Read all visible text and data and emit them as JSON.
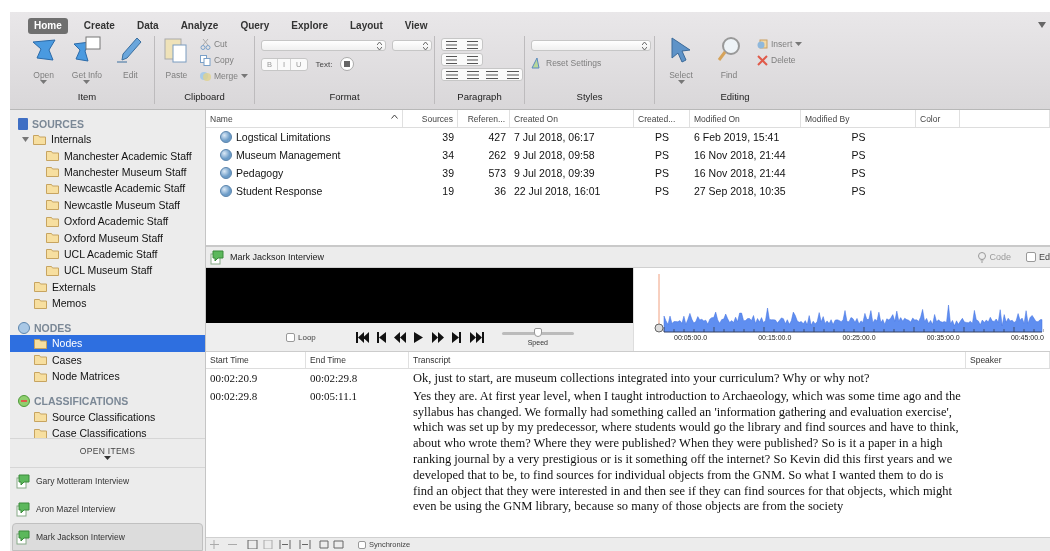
{
  "ribbon": {
    "tabs": [
      {
        "label": "Home",
        "selected": true
      },
      {
        "label": "Create",
        "selected": false
      },
      {
        "label": "Data",
        "selected": false
      },
      {
        "label": "Analyze",
        "selected": false
      },
      {
        "label": "Query",
        "selected": false
      },
      {
        "label": "Explore",
        "selected": false
      },
      {
        "label": "Layout",
        "selected": false
      },
      {
        "label": "View",
        "selected": false
      }
    ],
    "groups": [
      {
        "kind": "item",
        "label": "Item",
        "buttons": [
          {
            "label": "Open",
            "dropdown": true,
            "disabled": true
          },
          {
            "label": "Get Info",
            "dropdown": true,
            "disabled": true
          },
          {
            "label": "Edit",
            "dropdown": false,
            "disabled": true
          }
        ]
      },
      {
        "kind": "clipboard",
        "label": "Clipboard",
        "buttons": [
          {
            "label": "Paste",
            "dropdown": false,
            "disabled": true
          }
        ],
        "small_buttons": [
          {
            "label": "Cut",
            "dropdown": false,
            "disabled": true
          },
          {
            "label": "Copy",
            "dropdown": false,
            "disabled": true
          },
          {
            "label": "Merge",
            "dropdown": true,
            "disabled": true
          }
        ]
      },
      {
        "kind": "format",
        "label": "Format",
        "styles": [
          "B",
          "I",
          "U"
        ],
        "text_label": "Text:"
      },
      {
        "kind": "paragraph",
        "label": "Paragraph"
      },
      {
        "kind": "styles",
        "label": "Styles",
        "small_buttons": [
          {
            "label": "Reset Settings",
            "dropdown": false,
            "disabled": true
          }
        ]
      },
      {
        "kind": "editing",
        "label": "Editing",
        "buttons": [
          {
            "label": "Select",
            "dropdown": true,
            "disabled": true
          },
          {
            "label": "Find",
            "dropdown": false,
            "disabled": true
          }
        ],
        "small_buttons": [
          {
            "label": "Insert",
            "dropdown": true,
            "disabled": true
          },
          {
            "label": "Delete",
            "dropdown": false,
            "disabled": true
          }
        ]
      }
    ]
  },
  "sidebar": {
    "sections": [
      {
        "kind": "sources",
        "title": "SOURCES",
        "items": [
          {
            "label": "Internals",
            "selected": false,
            "expanded": true,
            "children": [
              {
                "label": "Manchester Academic Staff",
                "selected": false
              },
              {
                "label": "Manchester Museum Staff",
                "selected": false
              },
              {
                "label": "Newcastle Academic Staff",
                "selected": false
              },
              {
                "label": "Newcastle Museum Staff",
                "selected": false
              },
              {
                "label": "Oxford Academic Staff",
                "selected": false
              },
              {
                "label": "Oxford Museum Staff",
                "selected": false
              },
              {
                "label": "UCL Academic Staff",
                "selected": false
              },
              {
                "label": "UCL Museum Staff",
                "selected": false
              }
            ]
          },
          {
            "label": "Externals",
            "selected": false
          },
          {
            "label": "Memos",
            "selected": false
          }
        ]
      },
      {
        "kind": "nodes",
        "title": "NODES",
        "items": [
          {
            "label": "Nodes",
            "selected": true
          },
          {
            "label": "Cases",
            "selected": false
          },
          {
            "label": "Node Matrices",
            "selected": false
          }
        ]
      },
      {
        "kind": "classifications",
        "title": "CLASSIFICATIONS",
        "items": [
          {
            "label": "Source Classifications",
            "selected": false
          },
          {
            "label": "Case Classifications",
            "selected": false
          }
        ]
      }
    ],
    "open_items": {
      "title": "OPEN ITEMS",
      "items": [
        {
          "label": "Gary Motteram Interview",
          "selected": false
        },
        {
          "label": "Aron Mazel Interview",
          "selected": false
        },
        {
          "label": "Mark Jackson Interview",
          "selected": true
        }
      ]
    }
  },
  "list": {
    "columns": [
      {
        "label": "Name",
        "sorted": true
      },
      {
        "label": "Sources",
        "sorted": false
      },
      {
        "label": "Referen...",
        "sorted": false
      },
      {
        "label": "Created On",
        "sorted": false
      },
      {
        "label": "Created...",
        "sorted": false
      },
      {
        "label": "Modified On",
        "sorted": false
      },
      {
        "label": "Modified By",
        "sorted": false
      },
      {
        "label": "Color",
        "sorted": false
      }
    ],
    "rows": [
      {
        "cells": [
          "Logstical Limitations",
          "39",
          "427",
          "7 Jul 2018, 06:17",
          "PS",
          "6 Feb 2019, 15:41",
          "PS"
        ]
      },
      {
        "cells": [
          "Museum Management",
          "34",
          "262",
          "9 Jul 2018, 09:58",
          "PS",
          "16 Nov 2018, 21:44",
          "PS"
        ]
      },
      {
        "cells": [
          "Pedagogy",
          "39",
          "573",
          "9 Jul 2018, 09:39",
          "PS",
          "16 Nov 2018, 21:44",
          "PS"
        ]
      },
      {
        "cells": [
          "Student Response",
          "19",
          "36",
          "22 Jul 2018, 16:01",
          "PS",
          "27 Sep 2018, 10:35",
          "PS"
        ]
      }
    ]
  },
  "detail": {
    "title": "Mark Jackson Interview",
    "code_label": "Code",
    "edit_label": "Ed",
    "edit_checked": false,
    "media": {
      "loop": {
        "label": "Loop",
        "checked": false
      },
      "speed": {
        "label": "Speed",
        "level": 0.5
      },
      "time_labels": [
        "00:05:00.0",
        "00:15:00.0",
        "00:25:00.0",
        "00:35:00.0",
        "00:45:00.0"
      ]
    },
    "transcript": {
      "columns": [
        "Start Time",
        "End Time",
        "Transcript",
        "Speaker"
      ],
      "rows": [
        {
          "start": "00:02:20.9",
          "end": "00:02:29.8",
          "text": "Ok, just to start, are museum collections integrated into your curriculum? Why or why not?"
        },
        {
          "start": "00:02:29.8",
          "end": "00:05:11.1",
          "text": "Yes they are.  At first year level, when I taught introduction to Archaeology, which was some time ago and the syllabus has changed.  We formally had something called an 'information gathering and evaluation exercise', which was set up by my predecessor, where students would go the library and find sources and have to think, about who wrote them? Where they were published? When they were published?  So is it a paper in a high ranking journal by a very prestigious or is it something off the internet?  So Kevin did this first years and we developed that to be, to find sources for individual objects from the GNM.  So what I wanted them to do is find an object that they were interested in and then see if they can find sources for that objects, which might even be using the GNM library, because so many of those objects are from the society"
        }
      ]
    },
    "synchronize": {
      "label": "Synchronize",
      "checked": false
    }
  }
}
